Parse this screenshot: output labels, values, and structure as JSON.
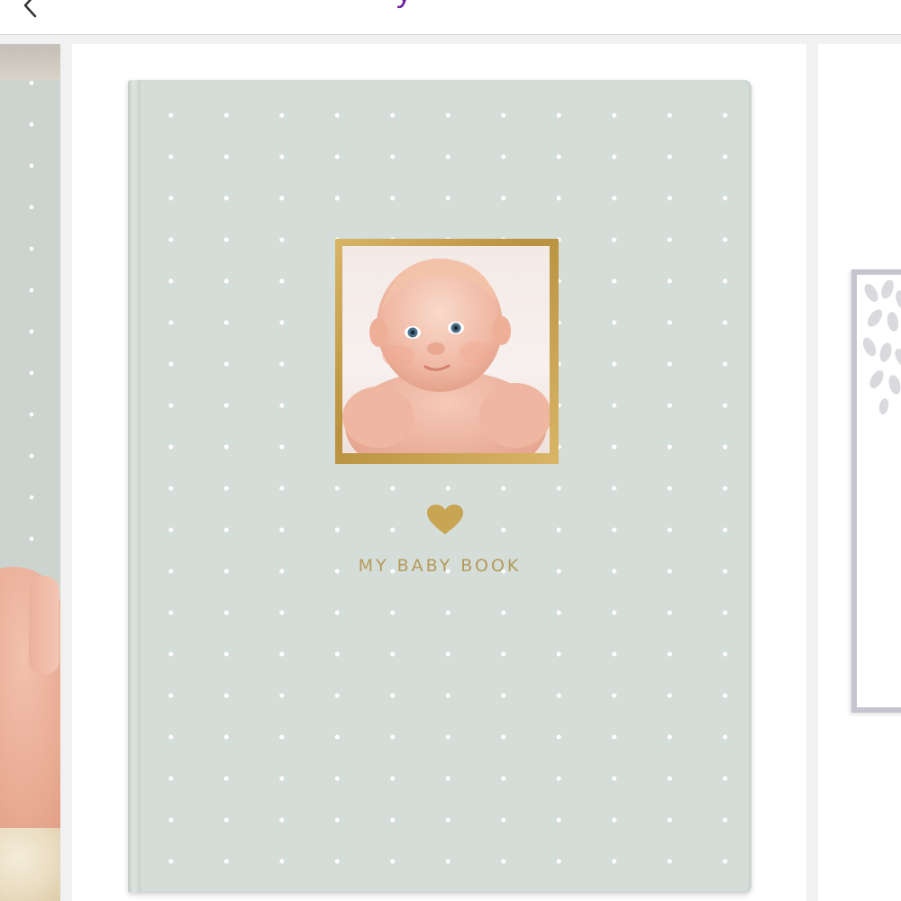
{
  "topbar": {
    "back_icon": "chevron-left-icon",
    "title_fragment": "y"
  },
  "gallery": {
    "main_item": {
      "cover_title": "MY BABY BOOK",
      "heart_icon": "heart-icon",
      "colors": {
        "cover": "#d5ddd9",
        "gold": "#b59a5a",
        "accent": "#6a1b9a"
      }
    }
  }
}
